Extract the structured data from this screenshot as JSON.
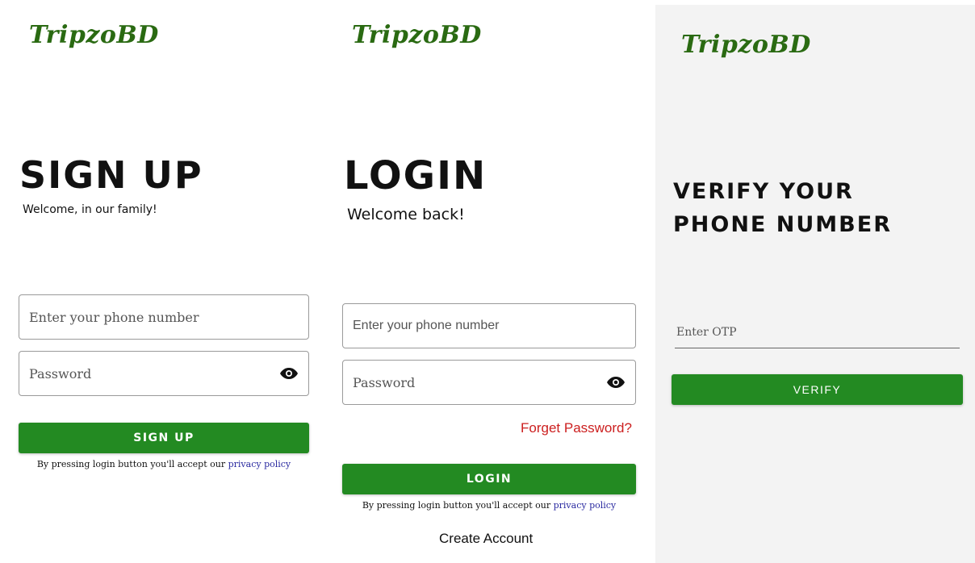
{
  "brand": "TripzoBD",
  "colors": {
    "brand_green": "#2a6a12",
    "button_green": "#238a22",
    "forgot_red": "#cc1f1f",
    "policy_link": "#2a2aa0",
    "verify_bg": "#f3f3f3"
  },
  "signup": {
    "title": "SIGN UP",
    "subtitle": "Welcome, in our family!",
    "phone_placeholder": "Enter your phone number",
    "password_placeholder": "Password",
    "button": "SIGN UP",
    "policy_text": "By pressing login button you'll accept our ",
    "policy_link": "privacy policy"
  },
  "login": {
    "title": "LOGIN",
    "subtitle": "Welcome back!",
    "phone_placeholder": "Enter your phone number",
    "password_placeholder": "Password",
    "forgot": "Forget Password?",
    "button": "LOGIN",
    "policy_text": "By pressing login button you'll accept our ",
    "policy_link": "privacy policy",
    "create_account": "Create Account"
  },
  "verify": {
    "title_line1": "VERIFY YOUR",
    "title_line2": "PHONE NUMBER",
    "otp_placeholder": "Enter OTP",
    "button": "VERIFY"
  }
}
